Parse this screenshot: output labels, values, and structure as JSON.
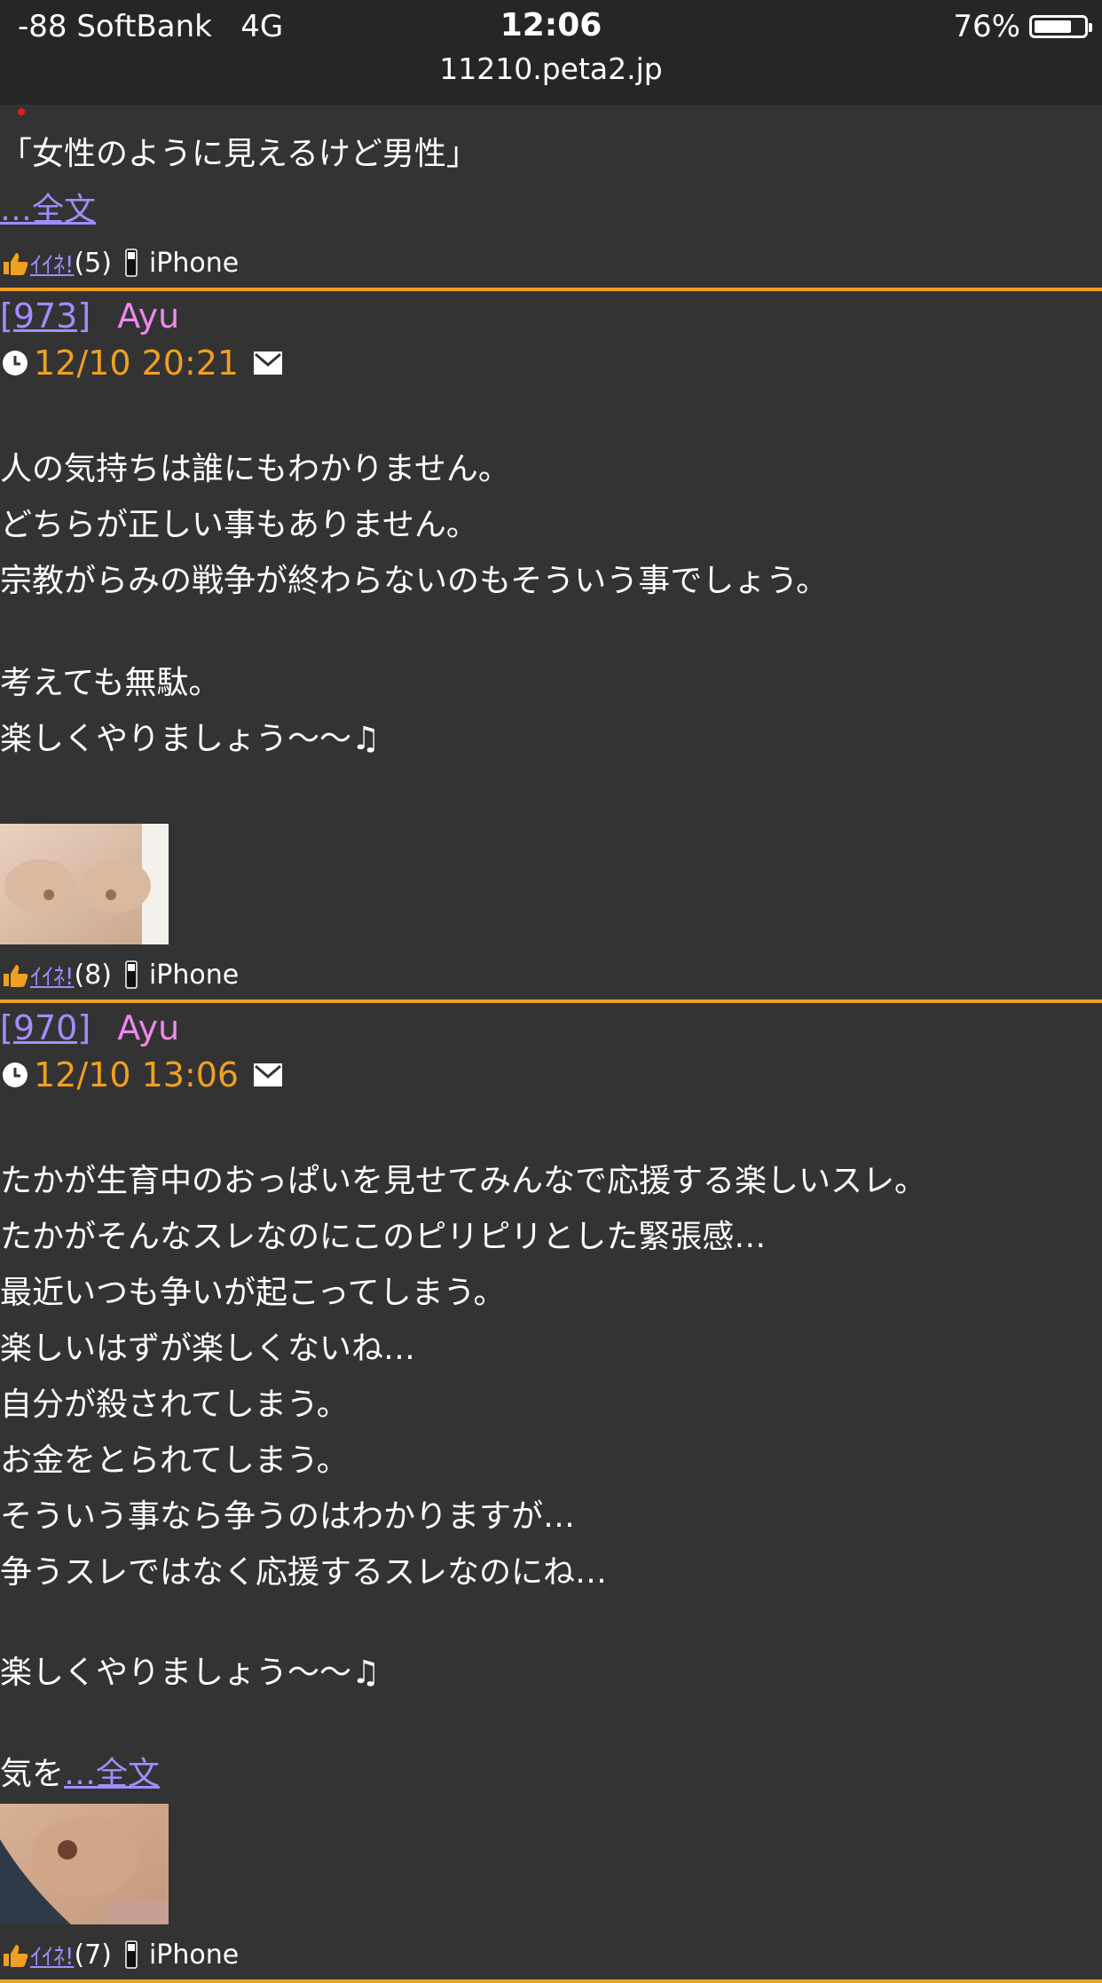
{
  "status_bar": {
    "carrier": "-88 SoftBank",
    "network": "4G",
    "time": "12:06",
    "url": "11210.peta2.jp",
    "battery_percent": "76%",
    "battery_level": 0.76
  },
  "top_fragment": {
    "text": "「女性のように見えるけど男性」",
    "more_link": "…全文",
    "iine_label": "ｲｲﾈ!",
    "iine_count": "(5)",
    "device": "iPhone"
  },
  "posts": [
    {
      "number": "[973]",
      "name": "Ayu",
      "date": "12/10 20:21",
      "lines": [
        "人の気持ちは誰にもわかりません。",
        "どちらが正しい事もありません。",
        "宗教がらみの戦争が終わらないのもそういう事でしょう。",
        "",
        "考えても無駄。",
        "楽しくやりましょう〜〜♫"
      ],
      "iine_label": "ｲｲﾈ!",
      "iine_count": "(8)",
      "device": "iPhone"
    },
    {
      "number": "[970]",
      "name": "Ayu",
      "date": "12/10 13:06",
      "lines": [
        "たかが生育中のおっぱいを見せてみんなで応援する楽しいスレ。",
        "たかがそんなスレなのにこのピリピリとした緊張感…",
        "最近いつも争いが起こってしまう。",
        "楽しいはずが楽しくないね…",
        "自分が殺されてしまう。",
        "お金をとられてしまう。",
        "そういう事なら争うのはわかりますが…",
        "争うスレではなく応援するスレなのにね…",
        "",
        "楽しくやりましょう〜〜♫",
        ""
      ],
      "last_line_prefix": "気を",
      "more_link": "…全文",
      "iine_label": "ｲｲﾈ!",
      "iine_count": "(7)",
      "device": "iPhone"
    }
  ],
  "colors": {
    "background": "#333333",
    "link": "#a48cff",
    "name": "#ee88ee",
    "date": "#f0a020",
    "divider": "#f0a020"
  }
}
